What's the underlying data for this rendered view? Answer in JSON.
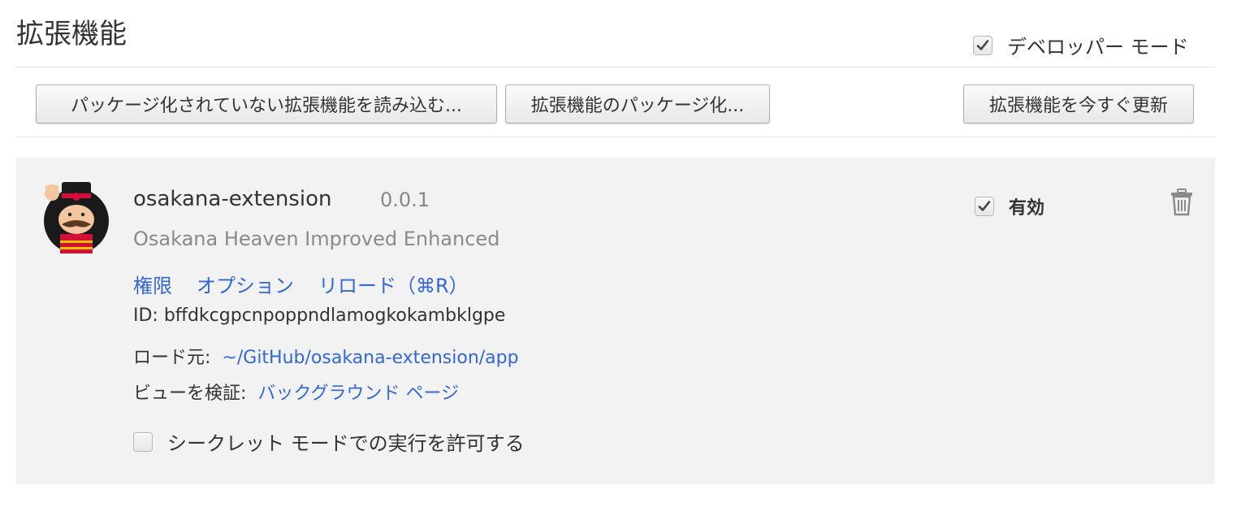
{
  "header": {
    "title": "拡張機能",
    "developer_mode_label": "デベロッパー モード",
    "developer_mode_checked": true
  },
  "toolbar": {
    "load_unpacked_label": "パッケージ化されていない拡張機能を読み込む...",
    "pack_label": "拡張機能のパッケージ化...",
    "update_label": "拡張機能を今すぐ更新"
  },
  "extension": {
    "name": "osakana-extension",
    "version": "0.0.1",
    "description": "Osakana Heaven Improved Enhanced",
    "links": {
      "permissions": "権限",
      "options": "オプション",
      "reload": "リロード（⌘R）"
    },
    "id_label": "ID:",
    "id_value": "bffdkcgpcnpoppndlamogkokambklgpe",
    "load_from_label": "ロード元:",
    "load_from_path": "~/GitHub/osakana-extension/app",
    "inspect_views_label": "ビューを検証:",
    "inspect_views_link": "バックグラウンド ページ",
    "incognito_label": "シークレット モードでの実行を許可する",
    "incognito_checked": false,
    "enabled_label": "有効",
    "enabled_checked": true,
    "avatar_icon": "beefeater-mascot-icon",
    "delete_icon": "trash-icon"
  },
  "colors": {
    "link": "#3367d6",
    "card_bg": "#f2f2f2"
  }
}
